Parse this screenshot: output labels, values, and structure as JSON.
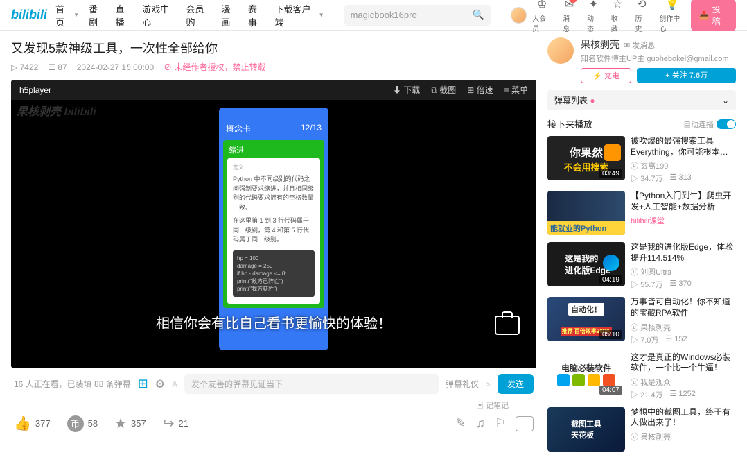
{
  "nav": {
    "logo": "bilibili",
    "links": [
      "首页",
      "番剧",
      "直播",
      "游戏中心",
      "会员购",
      "漫画",
      "赛事",
      "下载客户端"
    ]
  },
  "search": {
    "text": "magicbook16pro"
  },
  "userIcons": [
    {
      "label": "大会员"
    },
    {
      "label": "消息",
      "badge": "1"
    },
    {
      "label": "动态"
    },
    {
      "label": "收藏"
    },
    {
      "label": "历史"
    },
    {
      "label": "创作中心"
    }
  ],
  "uploadBtn": "投稿",
  "video": {
    "title": "又发现5款神级工具，一次性全部给你",
    "views": "7422",
    "danmaku": "87",
    "date": "2024-02-27 15:00:00",
    "warn": "未经作者授权，禁止转载",
    "player": "h5player",
    "topbtns": {
      "download": "下载",
      "screenshot": "截图",
      "speed": "倍速",
      "menu": "菜单"
    },
    "phone": {
      "header": "概念卡",
      "counter": "12/13",
      "greenHead": "缩进",
      "grayLabel": "定义",
      "para1": "Python 中不同级别的代码之间强制要求缩进，并且相同级别的代码要求拥有的空格数量一致。",
      "para2": "在这里第 1 到 3 行代码属于同一级别，第 4 和第 5 行代码属于同一级别。",
      "code": [
        "hp = 100",
        "damage = 250",
        "if hp - damage <= 0:",
        "    print(\"敌方已阵亡\")",
        "    print(\"我方获胜\")"
      ]
    },
    "subtitle": "相信你会有比自己看书更愉快的体验！"
  },
  "under": {
    "watching": "16 人正在看，已装填 88 条弹幕",
    "placeholder": "发个友善的弹幕见证当下",
    "gift": "弹幕礼仪",
    "send": "发送",
    "note": "记笔记"
  },
  "actions": {
    "like": "377",
    "coin": "58",
    "fav": "357",
    "share": "21"
  },
  "up": {
    "name": "果核剥壳",
    "msg": "发消息",
    "sig": "知名软件博主UP主 guohebokel@gmail.com",
    "charge": "充电",
    "follow": "+ 关注 7.6万"
  },
  "danmuList": "弹幕列表",
  "nextTitle": "接下来播放",
  "autoPlay": "自动连播",
  "recos": [
    {
      "title": "被吹爆的最强搜索工具Everything，你可能根本不…",
      "up": "玄离199",
      "v": "34.7万",
      "d": "313",
      "dur": "03:49"
    },
    {
      "title": "【Python入门到牛】爬虫开发+人工智能+数据分析",
      "up": "bilibili课堂",
      "v": "",
      "d": "",
      "dur": ""
    },
    {
      "title": "这是我的进化版Edge，体验提升114.514%",
      "up": "刘圆Ultra",
      "v": "55.7万",
      "d": "370",
      "dur": "04:19"
    },
    {
      "title": "万事皆可自动化！你不知道的宝藏RPA软件",
      "up": "果核剥壳",
      "v": "7.0万",
      "d": "152",
      "dur": "05:10"
    },
    {
      "title": "这才是真正的Windows必装软件，一个比一个牛逼！",
      "up": "我是观众",
      "v": "21.4万",
      "d": "1252",
      "dur": "04:07"
    },
    {
      "title": "梦想中的截图工具，终于有人做出来了！",
      "up": "果核剥壳",
      "v": "",
      "d": "",
      "dur": ""
    }
  ]
}
